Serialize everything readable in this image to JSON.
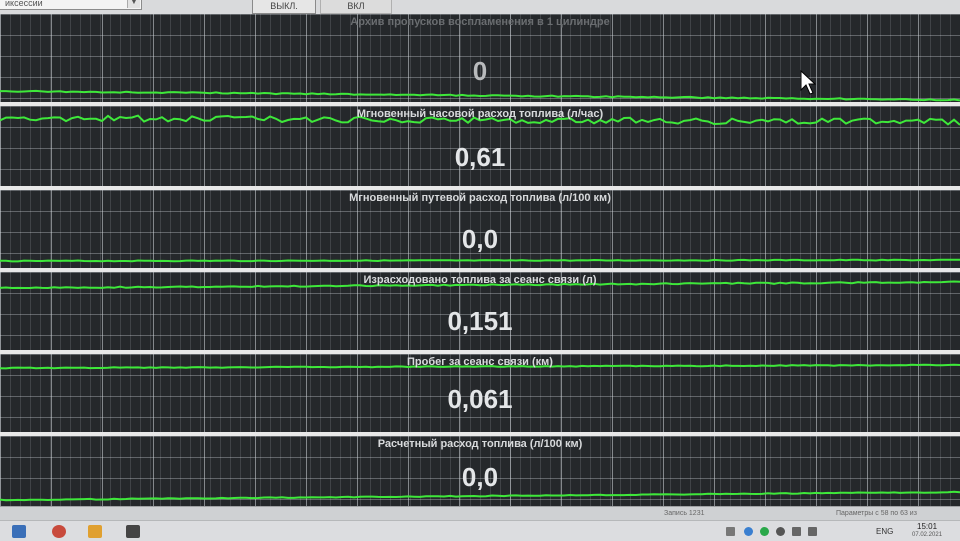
{
  "toolbar": {
    "mode_select": "иксессии",
    "btn_off": "ВЫКЛ.",
    "btn_on": "ВКЛ"
  },
  "panels": [
    {
      "id": "misfire",
      "title": "Архив пропусков воспламенения в 1 цилиндре",
      "value": "0"
    },
    {
      "id": "hourly-fuel",
      "title": "Мгновенный часовой расход топлива  (л/час)",
      "value": "0,61"
    },
    {
      "id": "trip-fuel",
      "title": "Мгновенный путевой расход топлива  (л/100 км)",
      "value": "0,0"
    },
    {
      "id": "fuel-used",
      "title": "Израсходовано топлива за сеанс связи  (л)",
      "value": "0,151"
    },
    {
      "id": "mileage",
      "title": "Пробег за сеанс связи  (км)",
      "value": "0,061"
    },
    {
      "id": "calc-fuel",
      "title": "Расчетный расход топлива  (л/100 км)",
      "value": "0,0"
    }
  ],
  "status": {
    "record": "Запись 1231",
    "params": "Параметры с 58 по 63 из"
  },
  "taskbar": {
    "lang": "ENG",
    "time": "15:01",
    "date": "07.02.2021"
  },
  "colors": {
    "trace": "#3ee83a",
    "panel_bg": "#25282b",
    "divider": "#e8e8e8"
  }
}
